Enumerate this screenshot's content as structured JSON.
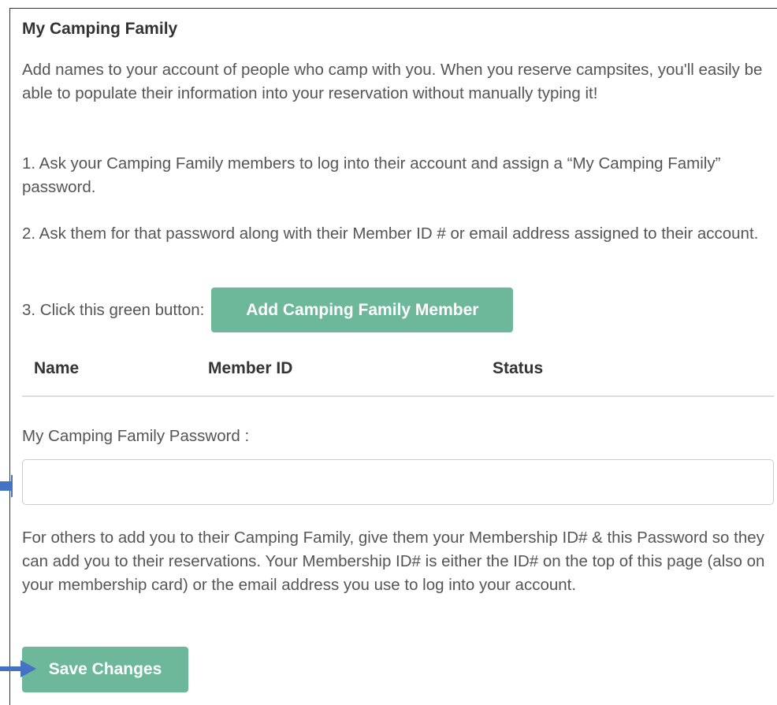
{
  "section": {
    "title": "My Camping Family",
    "intro": "Add names to your account of people who camp with you. When you reserve campsites, you'll easily be able to populate their information into your reservation without manually typing it!",
    "step1": "1. Ask your Camping Family members to log into their account and assign a “My Camping Family” password.",
    "step2": "2. Ask them for that password along with their Member ID # or email address assigned to their account.",
    "step3_label": "3. Click this green button:",
    "add_button_label": "Add Camping Family Member"
  },
  "table": {
    "columns": [
      "Name",
      "Member ID",
      "Status"
    ],
    "rows": []
  },
  "password": {
    "label": "My Camping Family Password :",
    "value": "",
    "placeholder": "",
    "help": "For others to add you to their Camping Family, give them your Membership ID# & this Password so they can add you to their reservations. Your Membership ID# is either the ID# on the top of this page (also on your membership card) or the email address you use to log into your account."
  },
  "actions": {
    "save_label": "Save Changes"
  },
  "colors": {
    "accent_button": "#6db89b",
    "annotation_arrow": "#4472c4",
    "body_text": "#555555",
    "heading_text": "#333333"
  },
  "icons": {
    "password_pointer": "arrow-right-icon",
    "save_pointer": "arrow-right-icon"
  }
}
